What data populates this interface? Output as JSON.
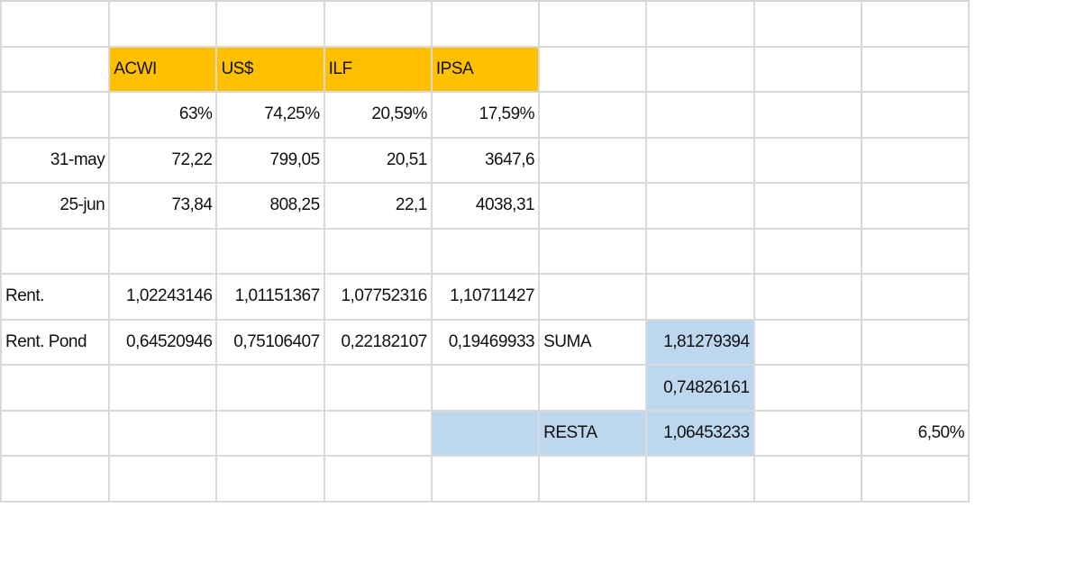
{
  "sheet": {
    "headers": [
      "ACWI",
      "US$",
      "ILF",
      "IPSA"
    ],
    "weights": [
      "63%",
      "74,25%",
      "20,59%",
      "17,59%"
    ],
    "row_may": {
      "label": "31-may",
      "values": [
        "72,22",
        "799,05",
        "20,51",
        "3647,6"
      ]
    },
    "row_jun": {
      "label": "25-jun",
      "values": [
        "73,84",
        "808,25",
        "22,1",
        "4038,31"
      ]
    },
    "rent": {
      "label": "Rent.",
      "values": [
        "1,02243146",
        "1,01151367",
        "1,07752316",
        "1,10711427"
      ]
    },
    "rent_pond": {
      "label": "Rent. Pond",
      "values": [
        "0,64520946",
        "0,75106407",
        "0,22182107",
        "0,19469933"
      ]
    },
    "suma": {
      "label": "SUMA",
      "value": "1,81279394"
    },
    "extra_value": "0,74826161",
    "resta": {
      "label": "RESTA",
      "value": "1,06453233",
      "percent": "6,50%"
    }
  },
  "colors": {
    "header_fill": "#ffc000",
    "highlight_fill": "#bdd7ee",
    "gridline": "#d9d9d9"
  }
}
